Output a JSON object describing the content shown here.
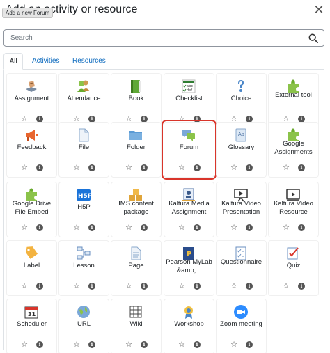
{
  "header": {
    "title": "Add an activity or resource",
    "tooltip": "Add a new Forum",
    "close_icon": "close-icon"
  },
  "search": {
    "placeholder": "Search"
  },
  "tabs": [
    {
      "label": "All",
      "active": true
    },
    {
      "label": "Activities",
      "active": false
    },
    {
      "label": "Resources",
      "active": false
    }
  ],
  "highlighted_item": "Forum",
  "colors": {
    "accent": "#0f6cbf",
    "highlight": "#d9352b"
  },
  "items": [
    {
      "label": "Assignment",
      "icon": "assignment-icon"
    },
    {
      "label": "Attendance",
      "icon": "attendance-icon"
    },
    {
      "label": "Book",
      "icon": "book-icon"
    },
    {
      "label": "Checklist",
      "icon": "checklist-icon"
    },
    {
      "label": "Choice",
      "icon": "choice-icon"
    },
    {
      "label": "External tool",
      "icon": "puzzle-icon"
    },
    {
      "label": "Feedback",
      "icon": "megaphone-icon"
    },
    {
      "label": "File",
      "icon": "file-icon"
    },
    {
      "label": "Folder",
      "icon": "folder-icon"
    },
    {
      "label": "Forum",
      "icon": "forum-icon"
    },
    {
      "label": "Glossary",
      "icon": "glossary-icon"
    },
    {
      "label": "Google Assignments",
      "icon": "puzzle-icon"
    },
    {
      "label": "Google Drive File Embed",
      "icon": "puzzle-icon"
    },
    {
      "label": "H5P",
      "icon": "h5p-icon"
    },
    {
      "label": "IMS content package",
      "icon": "package-icon"
    },
    {
      "label": "Kaltura Media Assignment",
      "icon": "media-assignment-icon"
    },
    {
      "label": "Kaltura Video Presentation",
      "icon": "video-presentation-icon"
    },
    {
      "label": "Kaltura Video Resource",
      "icon": "video-resource-icon"
    },
    {
      "label": "Label",
      "icon": "tag-icon"
    },
    {
      "label": "Lesson",
      "icon": "lesson-icon"
    },
    {
      "label": "Page",
      "icon": "page-icon"
    },
    {
      "label": "Pearson MyLab &amp;...",
      "icon": "pearson-icon"
    },
    {
      "label": "Questionnaire",
      "icon": "questionnaire-icon"
    },
    {
      "label": "Quiz",
      "icon": "quiz-icon"
    },
    {
      "label": "Scheduler",
      "icon": "calendar-icon"
    },
    {
      "label": "URL",
      "icon": "globe-icon"
    },
    {
      "label": "Wiki",
      "icon": "wiki-icon"
    },
    {
      "label": "Workshop",
      "icon": "workshop-icon"
    },
    {
      "label": "Zoom meeting",
      "icon": "zoom-icon"
    }
  ]
}
